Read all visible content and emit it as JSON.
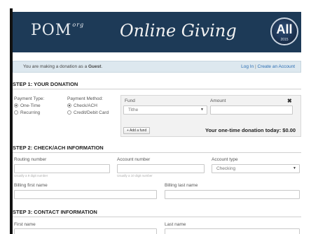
{
  "banner": {
    "logo": "POM",
    "logo_suffix": "org",
    "title": "Online Giving",
    "badge": "All",
    "badge_year": "2015"
  },
  "guest_bar": {
    "message_prefix": "You are making a donation as a ",
    "message_user": "Guest",
    "message_suffix": ".",
    "login_link": "Log In",
    "separator": " | ",
    "create_link": "Create an Account"
  },
  "step1": {
    "heading": "STEP 1: YOUR DONATION",
    "payment_type_label": "Payment Type:",
    "payment_type_options": [
      "One-Time",
      "Recurring"
    ],
    "payment_type_selected": "One-Time",
    "payment_method_label": "Payment Method:",
    "payment_method_options": [
      "Check/ACH",
      "Credit/Debit Card"
    ],
    "payment_method_selected": "Check/ACH",
    "fund_label": "Fund",
    "fund_value": "Tithe",
    "amount_label": "Amount",
    "amount_value": "",
    "add_fund_label": "+ Add a fund",
    "total_text": "Your one-time donation today: $0.00"
  },
  "step2": {
    "heading": "STEP 2: CHECK/ACH INFORMATION",
    "routing_label": "Routing number",
    "routing_hint": "Usually a 9 digit number",
    "account_label": "Account number",
    "account_hint": "Usually a 10 digit number",
    "account_type_label": "Account type",
    "account_type_value": "Checking",
    "billing_first_label": "Billing first name",
    "billing_last_label": "Billing last name"
  },
  "step3": {
    "heading": "STEP 3: CONTACT INFORMATION",
    "first_label": "First name",
    "last_label": "Last name"
  },
  "colors": {
    "banner_bg": "#1d3a57",
    "guest_bar_bg": "#dde8ef",
    "link": "#2a6db3",
    "fund_box_bg": "#f2f2f2"
  }
}
